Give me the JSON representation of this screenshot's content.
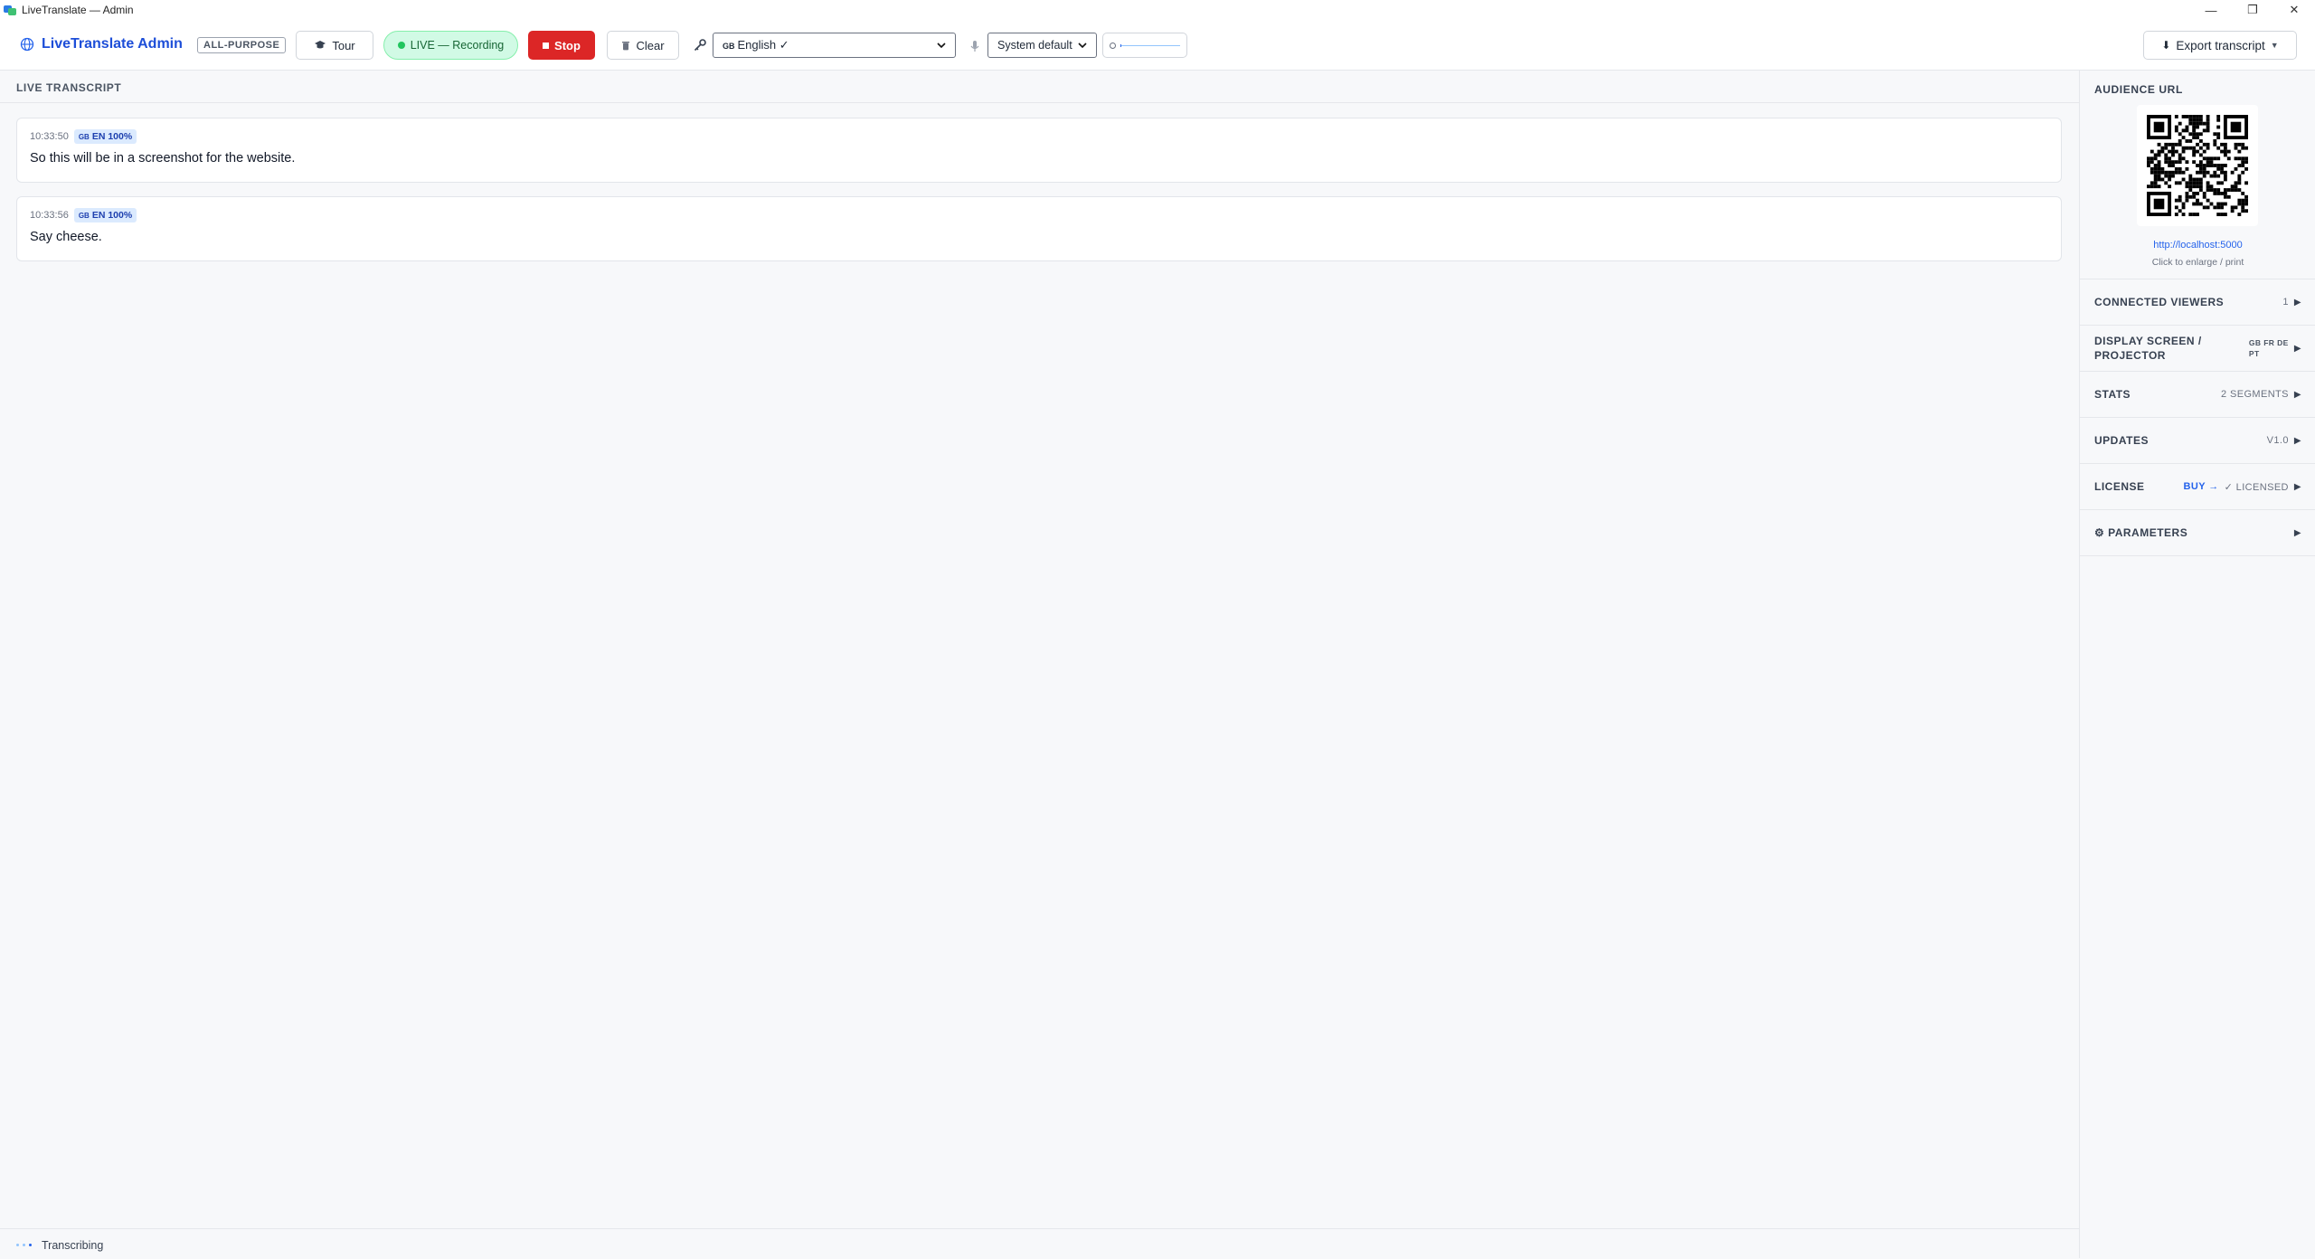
{
  "window": {
    "title": "LiveTranslate — Admin",
    "controls": {
      "minimize": "—",
      "maximize": "❐",
      "close": "✕"
    }
  },
  "header": {
    "app_name": "LiveTranslate Admin",
    "mode_badge": "ALL-PURPOSE",
    "tour_label": "Tour",
    "live_label": "LIVE — Recording",
    "stop_label": "Stop",
    "clear_label": "Clear",
    "language_select": {
      "flag": "GB",
      "value": "English ✓"
    },
    "audio_select": {
      "value": "System default"
    },
    "audio_level": 0.02,
    "export_label": "Export transcript"
  },
  "transcript": {
    "title": "LIVE TRANSCRIPT",
    "segments": [
      {
        "time": "10:33:50",
        "lang": "GB",
        "confidence": "EN 100%",
        "text": "So this will be in a screenshot for the website."
      },
      {
        "time": "10:33:56",
        "lang": "GB",
        "confidence": "EN 100%",
        "text": "Say cheese."
      }
    ]
  },
  "status": {
    "label": "Transcribing"
  },
  "sidebar": {
    "audience": {
      "title": "AUDIENCE URL",
      "url": "http://localhost:5000",
      "hint": "Click to enlarge / print"
    },
    "sections": [
      {
        "title": "CONNECTED VIEWERS",
        "value": "1"
      },
      {
        "title": "DISPLAY SCREEN / PROJECTOR",
        "flags": "GB FR DE PT"
      },
      {
        "title": "STATS",
        "value": "2 SEGMENTS"
      },
      {
        "title": "UPDATES",
        "value": "V1.0"
      },
      {
        "title": "LICENSE",
        "buy": "BUY →",
        "value": "✓ LICENSED"
      },
      {
        "title": "⚙ PARAMETERS",
        "value": ""
      }
    ]
  },
  "colors": {
    "accent": "#1d4ed8",
    "live_bg": "#d1fae5",
    "stop": "#dc2626",
    "link": "#2563eb"
  }
}
